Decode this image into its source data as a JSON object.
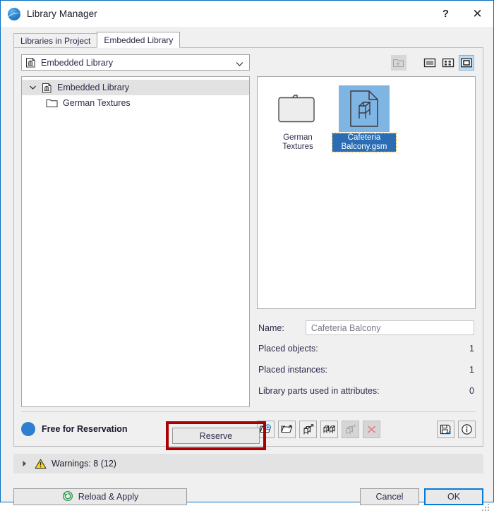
{
  "window": {
    "title": "Library Manager",
    "icon": "archicad-globe-icon",
    "help_label": "?",
    "close_label": "✕"
  },
  "tabs": [
    {
      "label": "Libraries in Project",
      "active": false
    },
    {
      "label": "Embedded Library",
      "active": true
    }
  ],
  "combo": {
    "value": "Embedded Library",
    "icon": "library-building-icon",
    "arrow": "chevron-down-icon"
  },
  "view_toolbar": {
    "up_folder": {
      "name": "go-up-folder-icon",
      "enabled": false
    },
    "modes": [
      {
        "name": "list-view-icon",
        "selected": false
      },
      {
        "name": "details-view-icon",
        "selected": false
      },
      {
        "name": "large-icons-view-icon",
        "selected": true
      }
    ]
  },
  "tree": [
    {
      "label": "Embedded Library",
      "icon": "library-building-icon",
      "selected": true,
      "expanded": true,
      "level": 0
    },
    {
      "label": "German Textures",
      "icon": "folder-icon",
      "selected": false,
      "level": 1
    }
  ],
  "grid": [
    {
      "label": "German Textures",
      "type": "folder",
      "selected": false
    },
    {
      "label": "Cafeteria Balcony.gsm",
      "type": "object-file",
      "selected": true
    }
  ],
  "details": {
    "name_label": "Name:",
    "name_value": "Cafeteria Balcony",
    "rows": [
      {
        "label": "Placed objects:",
        "value": "1"
      },
      {
        "label": "Placed instances:",
        "value": "1"
      },
      {
        "label": "Library parts used in attributes:",
        "value": "0"
      }
    ]
  },
  "reservation": {
    "status": "Free for Reservation",
    "status_color": "#2f7fd0",
    "button_label": "Reserve",
    "highlight_color": "#aa0000"
  },
  "action_toolbar": [
    {
      "name": "add-library-part-icon",
      "enabled": true
    },
    {
      "name": "export-folder-icon",
      "enabled": true
    },
    {
      "name": "export-object-icon",
      "enabled": true
    },
    {
      "name": "duplicate-objects-icon",
      "enabled": true
    },
    {
      "name": "move-object-icon",
      "enabled": false
    },
    {
      "name": "delete-object-icon",
      "enabled": false
    }
  ],
  "action_toolbar_right": [
    {
      "name": "save-as-icon",
      "enabled": true
    },
    {
      "name": "info-icon",
      "enabled": true
    }
  ],
  "warnings": {
    "expand_icon": "triangle-right-icon",
    "warning_icon": "warning-triangle-icon",
    "text": "Warnings: 8 (12)"
  },
  "footer": {
    "reload_label": "Reload & Apply",
    "reload_icon": "refresh-icon",
    "cancel_label": "Cancel",
    "ok_label": "OK"
  }
}
